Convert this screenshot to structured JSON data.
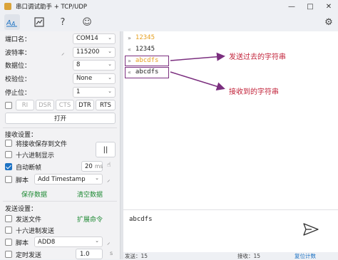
{
  "window": {
    "title": "串口调试助手 + TCP/UDP",
    "minimize": "—",
    "maximize": "□",
    "close": "✕"
  },
  "toolbar": {
    "icons": [
      "font-icon",
      "chart-icon",
      "help-icon",
      "smile-icon",
      "settings-icon"
    ],
    "help_glyph": "?",
    "smile_glyph": "☺",
    "gear_glyph": "⚙"
  },
  "serial": {
    "port_label": "端口名：",
    "port_value": "COM14",
    "baud_label": "波特率：",
    "baud_value": "115200",
    "databits_label": "数据位：",
    "databits_value": "8",
    "parity_label": "校验位：",
    "parity_value": "None",
    "stopbits_label": "停止位：",
    "stopbits_value": "1",
    "signals": [
      "RI",
      "DSR",
      "CTS",
      "DTR",
      "RTS"
    ],
    "open_label": "打开"
  },
  "receive": {
    "section": "接收设置：",
    "save_to_file": "将接收保存到文件",
    "hex_display": "十六进制显示",
    "auto_frame": "自动断帧",
    "pause_glyph": "||",
    "frame_ms_value": "20",
    "frame_ms_unit": "ms",
    "script_label": "脚本",
    "script_value": "Add Timestamp",
    "save_data": "保存数据",
    "clear_display": "清空数据"
  },
  "send": {
    "section": "发送设置：",
    "send_file": "发送文件",
    "expand_cmd": "扩展命令",
    "hex_send": "十六进制发送",
    "script_label": "脚本",
    "script_value": "ADD8",
    "timer_label": "定时发送",
    "timer_value": "1.0",
    "timer_unit": "s"
  },
  "messages": [
    {
      "dir": "»",
      "text": "12345",
      "color": "#e6a020"
    },
    {
      "dir": "«",
      "text": "12345",
      "color": "#1f1f1f"
    },
    {
      "dir": "»",
      "text": "abcdfs",
      "color": "#e6a020"
    },
    {
      "dir": "«",
      "text": "abcdfs",
      "color": "#1f1f1f"
    }
  ],
  "annotations": {
    "sent": "发送过去的字符串",
    "received": "接收到的字符串"
  },
  "input": {
    "text": "abcdfs"
  },
  "status": {
    "sent": "发送：15",
    "received": "接收：15",
    "reset": "复位计数"
  },
  "colors": {
    "accent": "#1e73c4",
    "link": "#1e8a34",
    "annotation": "#c2233a",
    "box": "#7b2f7f"
  }
}
